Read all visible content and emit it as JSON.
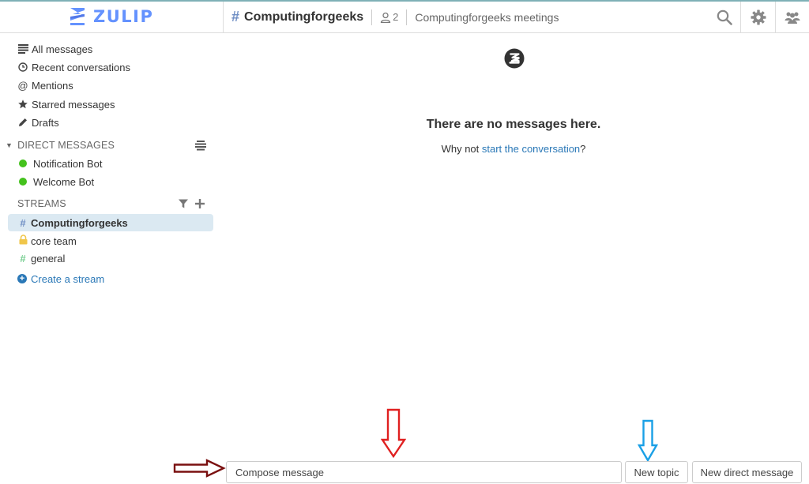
{
  "app": {
    "logo_text": "ZULIP",
    "brand_color": "#6492fe"
  },
  "header": {
    "stream_name": "Computingforgeeks",
    "subscriber_count": "2",
    "stream_description": "Computingforgeeks meetings",
    "icons": [
      "search-icon",
      "gear-icon",
      "users-icon"
    ]
  },
  "sidebar": {
    "views": [
      {
        "label": "All messages",
        "icon": "all-messages-icon"
      },
      {
        "label": "Recent conversations",
        "icon": "clock-icon"
      },
      {
        "label": "Mentions",
        "icon": "at-icon"
      },
      {
        "label": "Starred messages",
        "icon": "star-icon"
      },
      {
        "label": "Drafts",
        "icon": "pencil-icon"
      }
    ],
    "direct_messages": {
      "header": "DIRECT MESSAGES",
      "items": [
        {
          "label": "Notification Bot",
          "status_color": "#44c21d"
        },
        {
          "label": "Welcome Bot",
          "status_color": "#44c21d"
        }
      ]
    },
    "streams": {
      "header": "STREAMS",
      "items": [
        {
          "label": "Computingforgeeks",
          "icon": "#",
          "active": true,
          "color": "#6f8ec4"
        },
        {
          "label": "core team",
          "icon": "lock-icon",
          "active": false,
          "color": "#f0c64a"
        },
        {
          "label": "general",
          "icon": "#",
          "active": false,
          "color": "#76ce90"
        }
      ],
      "create_label": "Create a stream"
    }
  },
  "main": {
    "empty_title": "There are no messages here.",
    "empty_prefix": "Why not ",
    "empty_link": "start the conversation",
    "empty_suffix": "?"
  },
  "compose": {
    "placeholder": "Compose message",
    "new_topic_label": "New topic",
    "new_dm_label": "New direct message"
  },
  "annotations": {
    "arrow_dark_red": "#7a1010",
    "arrow_red": "#e02020",
    "arrow_blue": "#1aa0e6"
  }
}
